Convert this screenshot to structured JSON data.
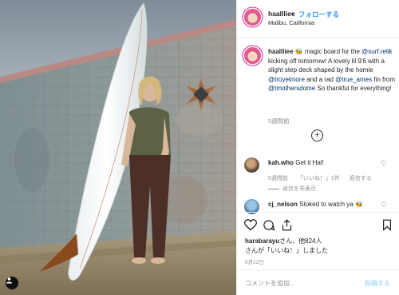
{
  "post": {
    "username": "haallliee",
    "separator": "•",
    "follow_label": "フォローする",
    "location": "Malibu, California"
  },
  "caption": {
    "username": "haallliee",
    "text_1": "🐝 magic board for the",
    "mention_1": "@surf.relik",
    "text_2": " kicking off tomorrow! A lovely lil 9'6 with a slight step deck shaped by the homie ",
    "mention_2": "@troyelmore",
    "text_3": " and a rad ",
    "mention_3": "@true_ames",
    "text_4": " fin from ",
    "mention_4": "@tmothersdome",
    "text_5": " So thankful for everything!",
    "time": "5週間前"
  },
  "more_comments_label": "+",
  "comments": [
    {
      "username": "kah.who",
      "text": "Get it Hal!",
      "time": "5週間前",
      "likes": "「いいね！」1件",
      "reply": "返信する",
      "hide_replies": "返信を非表示"
    },
    {
      "username": "cj_nelson",
      "text": "Stoked to watch ya 🐝"
    }
  ],
  "likes": {
    "liker": "harabarayu",
    "line_1": "さん、他824人",
    "line_2": "さんが「いいね！」しました"
  },
  "date": "6月22日",
  "comment_input": {
    "placeholder": "コメントを追加...",
    "post_label": "投稿する"
  },
  "icons": {
    "heart": "heart-icon",
    "comment": "comment-icon",
    "share": "share-icon",
    "bookmark": "bookmark-icon",
    "user_tag": "user-tag-icon"
  },
  "colors": {
    "link": "#3897f0",
    "mention": "#003569",
    "muted": "#8e8e8e",
    "border": "#efefef"
  }
}
